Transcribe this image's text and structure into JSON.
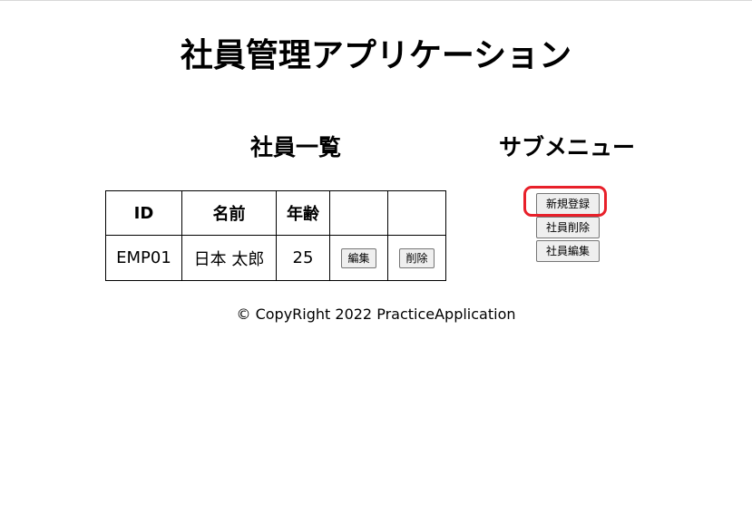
{
  "app": {
    "title": "社員管理アプリケーション"
  },
  "employee_list": {
    "title": "社員一覧",
    "columns": [
      "ID",
      "名前",
      "年齢",
      "",
      ""
    ],
    "rows": [
      {
        "id": "EMP01",
        "name": "日本 太郎",
        "age": "25",
        "edit_label": "編集",
        "delete_label": "削除"
      }
    ]
  },
  "submenu": {
    "title": "サブメニュー",
    "items": [
      {
        "label": "新規登録",
        "highlighted": true
      },
      {
        "label": "社員削除",
        "highlighted": false
      },
      {
        "label": "社員編集",
        "highlighted": false
      }
    ]
  },
  "footer": {
    "text": "© CopyRight 2022 PracticeApplication"
  },
  "colors": {
    "highlight": "#e8202a",
    "button_bg": "#efefef",
    "button_border": "#767676"
  }
}
